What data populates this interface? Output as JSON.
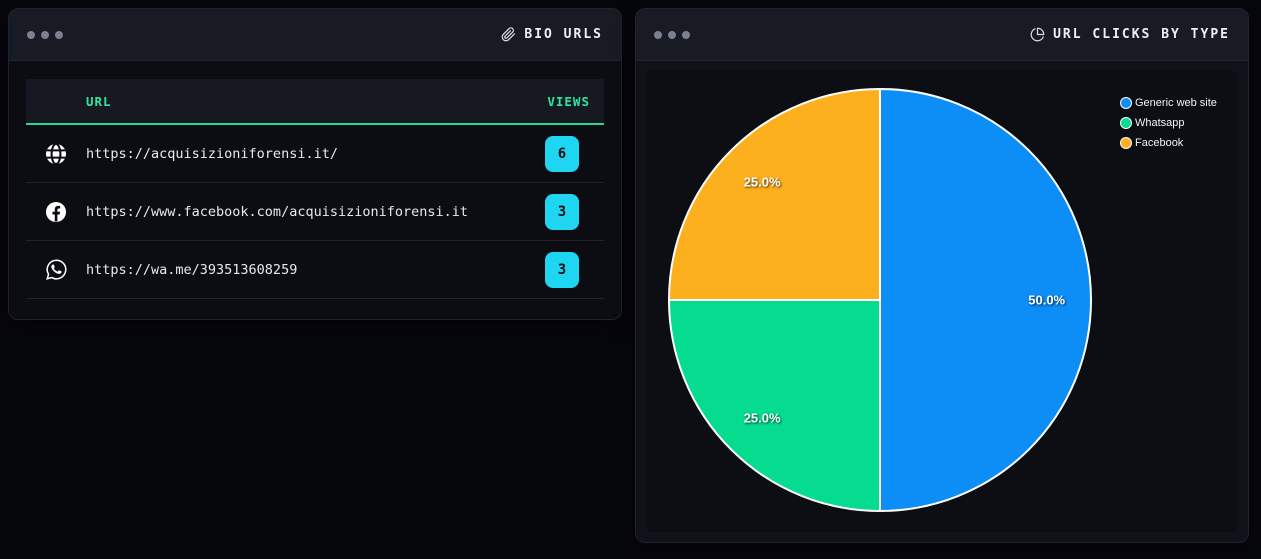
{
  "left_panel": {
    "title": "BIO URLS",
    "title_icon": "paperclip-icon",
    "table": {
      "col_url": "URL",
      "col_views": "VIEWS",
      "rows": [
        {
          "icon": "globe-icon",
          "url": "https://acquisizioniforensi.it/",
          "views": "6"
        },
        {
          "icon": "facebook-icon",
          "url": "https://www.facebook.com/acquisizioniforensi.it",
          "views": "3"
        },
        {
          "icon": "whatsapp-icon",
          "url": "https://wa.me/393513608259",
          "views": "3"
        }
      ]
    }
  },
  "right_panel": {
    "title": "URL CLICKS BY TYPE",
    "title_icon": "pie-chart-icon"
  },
  "chart_data": {
    "type": "pie",
    "title": "URL CLICKS BY TYPE",
    "series": [
      {
        "name": "Generic web site",
        "value": 50.0,
        "label": "50.0%",
        "color": "#0d8df6"
      },
      {
        "name": "Whatsapp",
        "value": 25.0,
        "label": "25.0%",
        "color": "#05dc8f"
      },
      {
        "name": "Facebook",
        "value": 25.0,
        "label": "25.0%",
        "color": "#fdb01e"
      }
    ],
    "start_angle_deg": 0,
    "direction": "clockwise",
    "slice_edge_color": "#ffffff",
    "legend_position": "upper right"
  },
  "colors": {
    "accent_green": "#2ee6a0",
    "badge_cyan": "#1fd6f2",
    "panel_bg": "#0c0d13",
    "header_bg": "#191b24",
    "page_bg": "#06060d"
  }
}
